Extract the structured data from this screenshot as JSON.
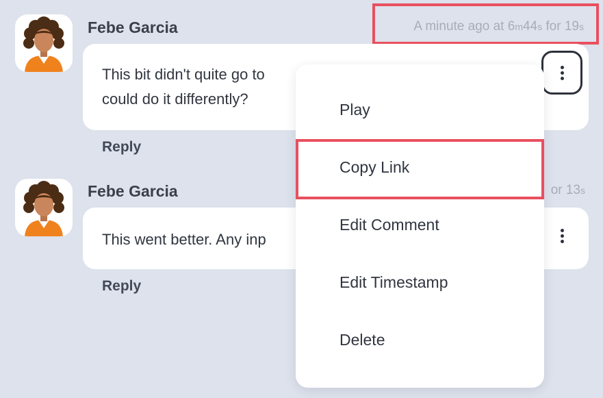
{
  "colors": {
    "background": "#dde2ec",
    "card": "#ffffff",
    "highlight": "#e8505f",
    "avatar_shirt": "#f0821e",
    "avatar_hair": "#4b2c14",
    "avatar_skin": "#c9855b"
  },
  "comments": [
    {
      "author": "Febe Garcia",
      "avatar_icon": "woman-avatar-icon",
      "meta": {
        "prefix": "A minute ago at 6",
        "minutes_unit": "m",
        "seconds_value": "44",
        "seconds_unit": "s",
        "duration_prefix": " for 19",
        "duration_unit": "s"
      },
      "text_line1": "This bit didn't quite go to",
      "text_line2": "could do it differently?",
      "menu_icon": "more-vertical-icon",
      "reply_label": "Reply"
    },
    {
      "author": "Febe Garcia",
      "avatar_icon": "woman-avatar-icon",
      "meta": {
        "visible_tail": "or 13",
        "duration_unit": "s"
      },
      "text_line1": "This went better. Any inp",
      "menu_icon": "more-vertical-icon",
      "reply_label": "Reply"
    }
  ],
  "context_menu": {
    "items": [
      "Play",
      "Copy Link",
      "Edit Comment",
      "Edit Timestamp",
      "Delete"
    ]
  }
}
